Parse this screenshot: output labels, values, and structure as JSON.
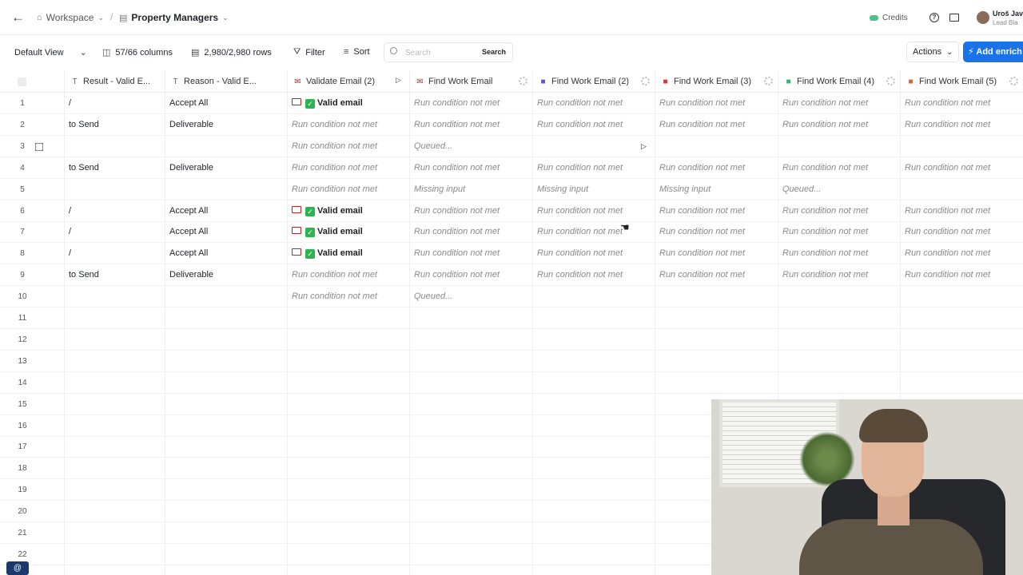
{
  "breadcrumb": {
    "workspace": "Workspace",
    "table": "Property Managers"
  },
  "header": {
    "credits_label": "Credits",
    "user_name": "Uroš Jav",
    "user_role": "Lead Bla"
  },
  "toolbar": {
    "view": "Default View",
    "columns": "57/66 columns",
    "rows": "2,980/2,980 rows",
    "filter": "Filter",
    "sort": "Sort",
    "search_placeholder": "Search",
    "search_button": "Search",
    "actions": "Actions",
    "add_enrichment": "Add enrich"
  },
  "columns": [
    {
      "label": "Result - Valid E...",
      "icon": "text-icon"
    },
    {
      "label": "Reason - Valid E...",
      "icon": "text-icon"
    },
    {
      "label": "Validate Email (2)",
      "icon": "mail-icon"
    },
    {
      "label": "Find Work Email",
      "icon": "mail-icon"
    },
    {
      "label": "Find Work Email (2)",
      "icon": "provider-icon",
      "color": "#6b4fd8"
    },
    {
      "label": "Find Work Email (3)",
      "icon": "provider-icon",
      "color": "#d23a3a"
    },
    {
      "label": "Find Work Email (4)",
      "icon": "provider-icon",
      "color": "#3cb371"
    },
    {
      "label": "Find Work Email (5)",
      "icon": "provider-icon",
      "color": "#e0602b"
    }
  ],
  "rows": [
    {
      "n": "1",
      "cells": [
        "/",
        "Accept All",
        "Valid email",
        "Run condition not met",
        "Run condition not met",
        "Run condition not met",
        "Run condition not met",
        "Run condition not met"
      ]
    },
    {
      "n": "2",
      "cells": [
        "to Send",
        "Deliverable",
        "Run condition not met",
        "Run condition not met",
        "Run condition not met",
        "Run condition not met",
        "Run condition not met",
        "Run condition not met"
      ]
    },
    {
      "n": "3",
      "cells": [
        "",
        "",
        "Run condition not met",
        "Queued...",
        "",
        "",
        "",
        ""
      ]
    },
    {
      "n": "4",
      "cells": [
        "to Send",
        "Deliverable",
        "Run condition not met",
        "Run condition not met",
        "Run condition not met",
        "Run condition not met",
        "Run condition not met",
        "Run condition not met"
      ]
    },
    {
      "n": "5",
      "cells": [
        "",
        "",
        "Run condition not met",
        "Missing input",
        "Missing input",
        "Missing input",
        "Queued...",
        ""
      ]
    },
    {
      "n": "6",
      "cells": [
        "/",
        "Accept All",
        "Valid email",
        "Run condition not met",
        "Run condition not met",
        "Run condition not met",
        "Run condition not met",
        "Run condition not met"
      ]
    },
    {
      "n": "7",
      "cells": [
        "/",
        "Accept All",
        "Valid email",
        "Run condition not met",
        "Run condition not met",
        "Run condition not met",
        "Run condition not met",
        "Run condition not met"
      ]
    },
    {
      "n": "8",
      "cells": [
        "/",
        "Accept All",
        "Valid email",
        "Run condition not met",
        "Run condition not met",
        "Run condition not met",
        "Run condition not met",
        "Run condition not met"
      ]
    },
    {
      "n": "9",
      "cells": [
        "to Send",
        "Deliverable",
        "Run condition not met",
        "Run condition not met",
        "Run condition not met",
        "Run condition not met",
        "Run condition not met",
        "Run condition not met"
      ]
    },
    {
      "n": "10",
      "cells": [
        "",
        "",
        "Run condition not met",
        "Queued...",
        "",
        "",
        "",
        ""
      ]
    },
    {
      "n": "11",
      "cells": [
        "",
        "",
        "",
        "",
        "",
        "",
        "",
        ""
      ]
    },
    {
      "n": "12",
      "cells": [
        "",
        "",
        "",
        "",
        "",
        "",
        "",
        ""
      ]
    },
    {
      "n": "13",
      "cells": [
        "",
        "",
        "",
        "",
        "",
        "",
        "",
        ""
      ]
    },
    {
      "n": "14",
      "cells": [
        "",
        "",
        "",
        "",
        "",
        "",
        "",
        ""
      ]
    },
    {
      "n": "15",
      "cells": [
        "",
        "",
        "",
        "",
        "",
        "",
        "",
        ""
      ]
    },
    {
      "n": "16",
      "cells": [
        "",
        "",
        "",
        "",
        "",
        "",
        "",
        ""
      ]
    },
    {
      "n": "17",
      "cells": [
        "",
        "",
        "",
        "",
        "",
        "",
        "",
        ""
      ]
    },
    {
      "n": "18",
      "cells": [
        "",
        "",
        "",
        "",
        "",
        "",
        "",
        ""
      ]
    },
    {
      "n": "19",
      "cells": [
        "",
        "",
        "",
        "",
        "",
        "",
        "",
        ""
      ]
    },
    {
      "n": "20",
      "cells": [
        "",
        "",
        "",
        "",
        "",
        "",
        "",
        ""
      ]
    },
    {
      "n": "21",
      "cells": [
        "",
        "",
        "",
        "",
        "",
        "",
        "",
        ""
      ]
    },
    {
      "n": "22",
      "cells": [
        "",
        "",
        "",
        "",
        "",
        "",
        "",
        ""
      ]
    }
  ],
  "footer_badge": "@"
}
